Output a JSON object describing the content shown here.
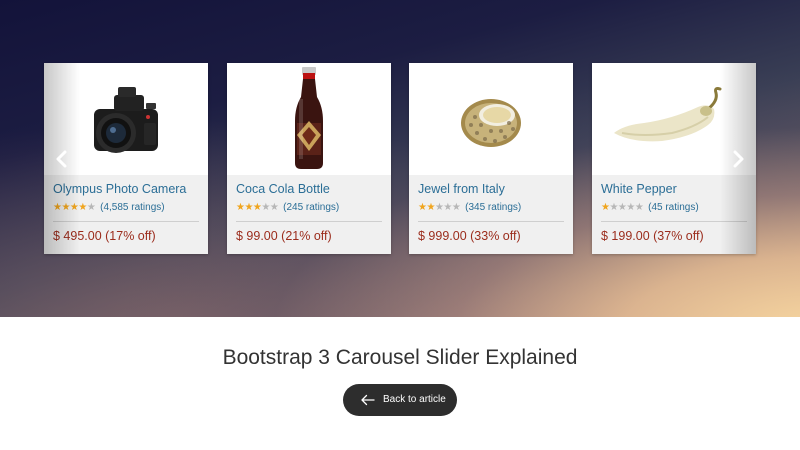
{
  "carousel": {
    "items": [
      {
        "title": "Olympus Photo Camera",
        "stars": 4,
        "ratings": "(4,585 ratings)",
        "price": "$ 495.00 (17% off)",
        "image": "camera-image"
      },
      {
        "title": "Coca Cola Bottle",
        "stars": 3,
        "ratings": "(245 ratings)",
        "price": "$ 99.00 (21% off)",
        "image": "bottle-image"
      },
      {
        "title": "Jewel from Italy",
        "stars": 2,
        "ratings": "(345 ratings)",
        "price": "$ 999.00 (33% off)",
        "image": "bracelet-image"
      },
      {
        "title": "White Pepper",
        "stars": 1,
        "ratings": "(45 ratings)",
        "price": "$ 199.00 (37% off)",
        "image": "pepper-image"
      }
    ],
    "prev_icon": "chevron-left-icon",
    "next_icon": "chevron-right-icon"
  },
  "page": {
    "caption": "Bootstrap 3 Carousel Slider Explained",
    "back_label": "Back to article",
    "back_icon": "arrow-left-icon"
  },
  "colors": {
    "title": "#2b6e96",
    "price": "#9b2c1c",
    "star_on": "#f0a51e",
    "star_off": "#b7b7b7",
    "button_bg": "#2d2d2d"
  }
}
